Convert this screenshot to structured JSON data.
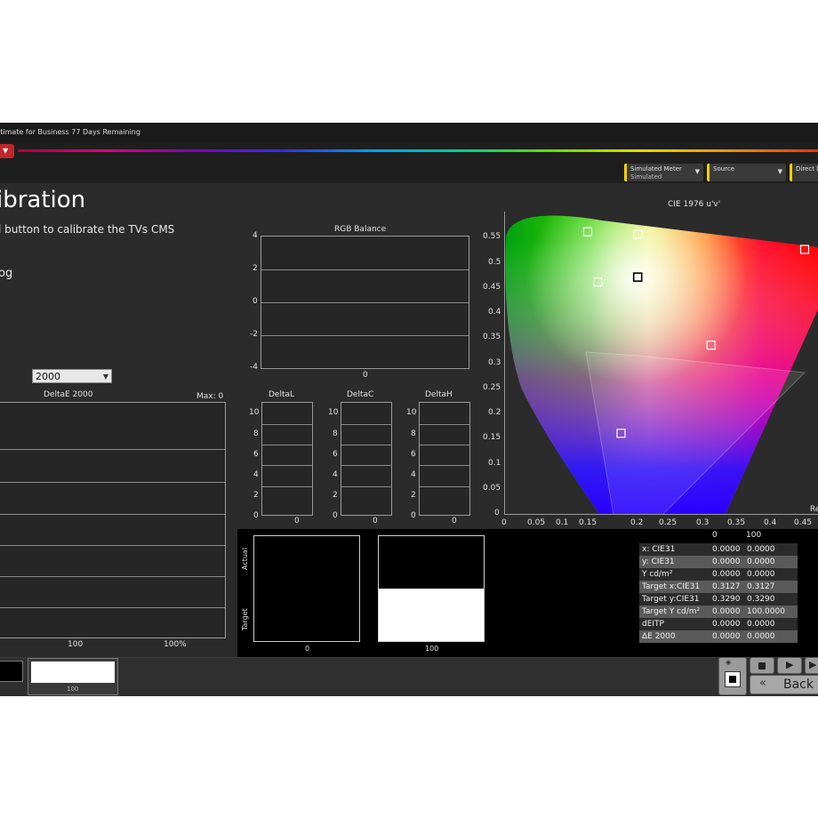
{
  "window": {
    "title": "ltimate for Business 77 Days Remaining"
  },
  "toolbar": {
    "meter": {
      "label": "Simulated Meter",
      "value": "Simulated"
    },
    "source": {
      "label": "Source"
    },
    "direct": {
      "label": "Direct D"
    }
  },
  "page": {
    "heading": "ibration",
    "instruction": "l button to calibrate the TVs CMS",
    "fragment": "og"
  },
  "deltae_select": {
    "value": "2000"
  },
  "charts": {
    "rgb_balance": {
      "title": "RGB Balance",
      "yticks": [
        "4",
        "2",
        "0",
        "-2",
        "-4"
      ],
      "xtick": "0"
    },
    "deltae": {
      "title": "DeltaE 2000",
      "max_label": "Max: 0",
      "xticks": [
        "100",
        "100%"
      ]
    },
    "deltal": {
      "title": "DeltaL",
      "yticks": [
        "10",
        "8",
        "6",
        "4",
        "2",
        "0"
      ],
      "xtick": "0"
    },
    "deltac": {
      "title": "DeltaC",
      "yticks": [
        "10",
        "8",
        "6",
        "4",
        "2",
        "0"
      ],
      "xtick": "0"
    },
    "deltah": {
      "title": "DeltaH",
      "yticks": [
        "10",
        "8",
        "6",
        "4",
        "2",
        "0"
      ],
      "xtick": "0"
    },
    "cie": {
      "title": "CIE 1976 u'v'",
      "right_label": "Re",
      "yticks": [
        "0.55",
        "0.5",
        "0.45",
        "0.4",
        "0.35",
        "0.3",
        "0.25",
        "0.2",
        "0.15",
        "0.1",
        "0.05",
        "0"
      ],
      "xticks": [
        "0",
        "0.05",
        "0.1",
        "0.15",
        "0.2",
        "0.25",
        "0.3",
        "0.35",
        "0.4",
        "0.45"
      ]
    }
  },
  "chart_data": {
    "type": "scatter",
    "title": "CIE 1976 u'v'",
    "xlim": [
      0,
      0.47
    ],
    "ylim": [
      0,
      0.6
    ],
    "grid": false,
    "x": [
      0.125,
      0.2,
      0.45,
      0.14,
      0.2,
      0.31,
      0.175
    ],
    "y": [
      0.56,
      0.555,
      0.525,
      0.46,
      0.47,
      0.335,
      0.16
    ]
  },
  "swatches": {
    "actual_label": "Actual",
    "target_label": "Target",
    "left_caption": "0",
    "right_caption": "100"
  },
  "table": {
    "headers": [
      "0",
      "100"
    ],
    "rows": [
      {
        "label": "x: CIE31",
        "v0": "0.0000",
        "v1": "0.0000"
      },
      {
        "label": "y: CIE31",
        "v0": "0.0000",
        "v1": "0.0000"
      },
      {
        "label": "Y cd/m²",
        "v0": "0.0000",
        "v1": "0.0000"
      },
      {
        "label": "Target x:CIE31",
        "v0": "0.3127",
        "v1": "0.3127"
      },
      {
        "label": "Target y:CIE31",
        "v0": "0.3290",
        "v1": "0.3290"
      },
      {
        "label": "Target Y cd/m²",
        "v0": "0.0000",
        "v1": "100.0000"
      },
      {
        "label": "dEITP",
        "v0": "0.0000",
        "v1": "0.0000"
      },
      {
        "label": "ΔE 2000",
        "v0": "0.0000",
        "v1": "0.0000"
      }
    ]
  },
  "bottom": {
    "swatch_label": "100",
    "back_label": "Back"
  }
}
